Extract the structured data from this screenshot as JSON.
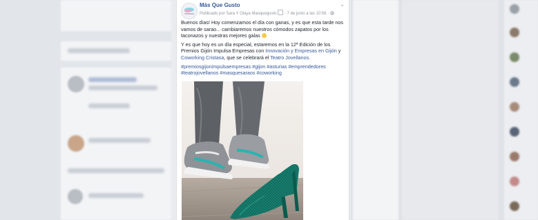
{
  "post": {
    "page_name": "Más Que Gusto",
    "meta_prefix": "Publicado por Sara Y Olaya Masquegusto",
    "meta_date": "· 7 de junio a las 10:56 ·",
    "intro": "Buenos días! Hoy comenzamos el día con ganas, y es que esta tarde nos vamos de sarao... cambiaremos nuestros cómodos zapatos por los taconazos y nuestras mejores galas",
    "event_part1": "Y es que hoy es un día especial, estaremos en la 12ª Edición de los Premios Gijón Impulsa Empresas con",
    "event_link1": "Innovación y Empresas en Gijón",
    "event_and": "y",
    "event_link2": "Coworking Cristasa",
    "event_part2": ", que se celebrará el",
    "event_link3": "Teatro Jovellanos.",
    "hashtags": [
      "#premiosgijonimpulsaempresas",
      "#gijon",
      "#asturias",
      "#emprendedores",
      "#teatrojovellanos",
      "#masquesaraos",
      "#coworking"
    ]
  },
  "colors": {
    "link": "#365899",
    "background": "#e9ebee",
    "sneaker_accent": "#2bb3b1",
    "heel": "#0f6a5c"
  },
  "icons": {
    "audience": "globe-icon",
    "menu": "chevron-down-icon",
    "emoji": "smiley-emoji"
  }
}
